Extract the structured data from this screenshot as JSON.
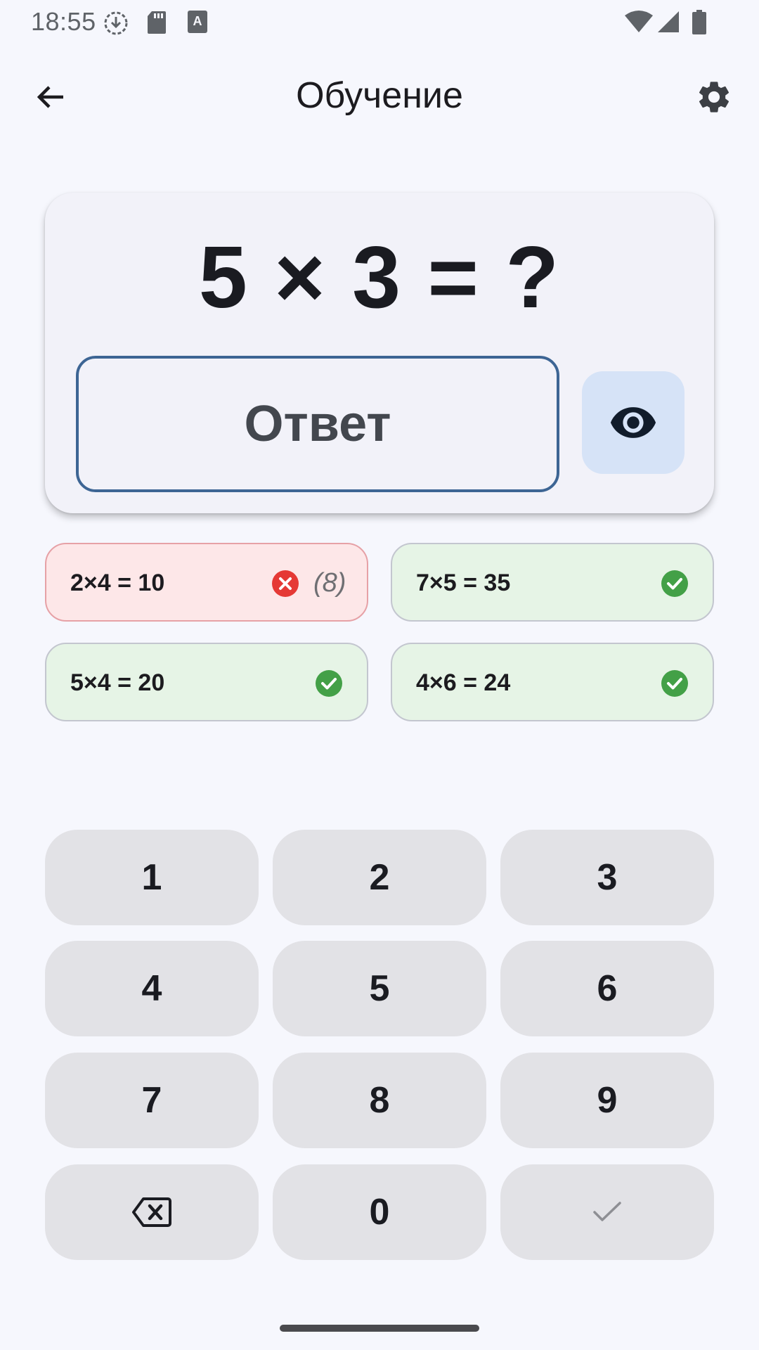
{
  "status_bar": {
    "time": "18:55",
    "icons": [
      "download-status-icon",
      "sd-card-icon",
      "keyboard-a-icon",
      "wifi-icon",
      "signal-icon",
      "battery-icon"
    ]
  },
  "app_bar": {
    "title": "Обучение",
    "back_icon": "arrow-back-icon",
    "settings_icon": "gear-icon"
  },
  "question_card": {
    "question": "5 × 3 = ?",
    "answer_placeholder": "Ответ",
    "reveal_icon": "eye-icon"
  },
  "history": [
    {
      "text": "2×4 = 10",
      "status": "wrong",
      "correct_hint": "(8)"
    },
    {
      "text": "7×5 = 35",
      "status": "correct"
    },
    {
      "text": "5×4 = 20",
      "status": "correct"
    },
    {
      "text": "4×6 = 24",
      "status": "correct"
    }
  ],
  "keypad": {
    "keys": [
      "1",
      "2",
      "3",
      "4",
      "5",
      "6",
      "7",
      "8",
      "9"
    ],
    "backspace_icon": "backspace-icon",
    "zero": "0",
    "submit_icon": "check-icon"
  },
  "colors": {
    "background": "#f6f7fd",
    "card": "#f2f2f9",
    "field_border": "#3d6594",
    "eye_button": "#d6e3f7",
    "chip_correct": "#e6f4e6",
    "chip_wrong": "#fde7e8",
    "correct_icon": "#43a047",
    "wrong_icon": "#e53935",
    "key": "#e2e2e6"
  }
}
